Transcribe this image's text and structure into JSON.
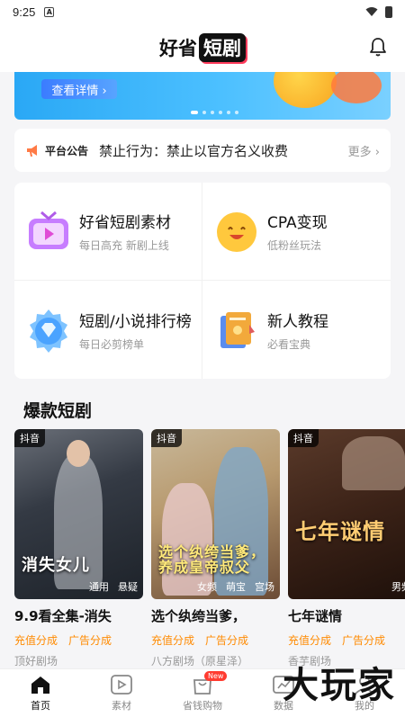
{
  "status_bar": {
    "time": "9:25",
    "a_icon": "A"
  },
  "header": {
    "logo_part1": "好省",
    "logo_part2": "短剧"
  },
  "banner": {
    "button_label": "查看详情 ›"
  },
  "notice": {
    "badge": "平台公告",
    "text": "禁止行为：禁止以官方名义收费",
    "more": "更多 ›"
  },
  "features": [
    {
      "title": "好省短剧素材",
      "subtitle": "每日高充 新剧上线",
      "icon": "tv-play-icon"
    },
    {
      "title": "CPA变现",
      "subtitle": "低粉丝玩法",
      "icon": "smile-face-icon"
    },
    {
      "title": "短剧/小说排行榜",
      "subtitle": "每日必剪榜单",
      "icon": "diamond-badge-icon"
    },
    {
      "title": "新人教程",
      "subtitle": "必看宝典",
      "icon": "book-icon"
    }
  ],
  "section_title": "爆款短剧",
  "dramas": [
    {
      "platform": "抖音",
      "tags": [
        "通用",
        "悬疑"
      ],
      "poster_text": "消失女儿",
      "title": "9.9看全集-消失",
      "chips": [
        "充值分成",
        "广告分成"
      ],
      "studio": "顶好剧场"
    },
    {
      "platform": "抖音",
      "tags": [
        "女频",
        "萌宝",
        "宫场"
      ],
      "poster_text": "选个纨绔当爹，养成皇帝叔父",
      "title": "选个纨绔当爹，",
      "chips": [
        "充值分成",
        "广告分成"
      ],
      "studio": "八方剧场（原星泽）"
    },
    {
      "platform": "抖音",
      "tags": [
        "男频"
      ],
      "poster_text": "七年谜情",
      "title": "七年谜情",
      "chips": [
        "充值分成",
        "广告分成"
      ],
      "studio": "香芋剧场"
    }
  ],
  "tabs": [
    {
      "label": "首页",
      "icon": "home-icon",
      "active": true
    },
    {
      "label": "素材",
      "icon": "play-icon",
      "active": false
    },
    {
      "label": "省钱购物",
      "icon": "shopping-bag-icon",
      "active": false,
      "badge": "New"
    },
    {
      "label": "数据",
      "icon": "data-icon",
      "active": false
    },
    {
      "label": "我的",
      "icon": "profile-icon",
      "active": false
    }
  ],
  "watermark": "大玩家",
  "colors": {
    "accent": "#ff8a00",
    "brand_pink": "#ff3b5c",
    "banner_blue": "#2aa8f5"
  }
}
